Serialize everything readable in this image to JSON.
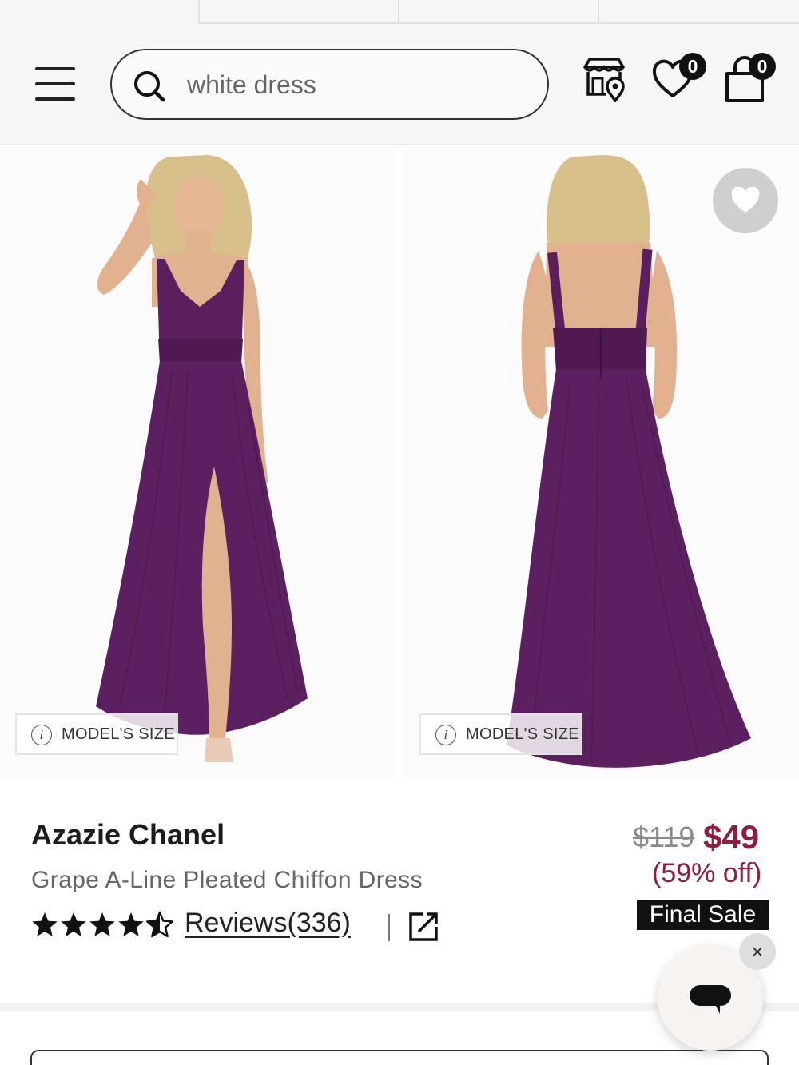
{
  "header": {
    "menu_icon": "hamburger-menu-icon",
    "search": {
      "value": "white dress",
      "placeholder": "",
      "icon": "search-icon"
    },
    "store_icon": "store-locator-icon",
    "wishlist": {
      "icon": "heart-icon",
      "count": "0"
    },
    "cart": {
      "icon": "shopping-bag-icon",
      "count": "0"
    }
  },
  "gallery": {
    "images": [
      {
        "alt": "Front view of model in grape chiffon dress",
        "model_size_label": "MODEL'S SIZE"
      },
      {
        "alt": "Back view of model in grape chiffon dress",
        "model_size_label": "MODEL'S SIZE"
      }
    ],
    "info_glyph": "i",
    "favorite_icon": "heart-icon"
  },
  "product": {
    "name": "Azazie Chanel",
    "description": "Grape A-Line Pleated Chiffon Dress",
    "rating": 4.5,
    "rating_max": 5,
    "reviews_label": "Reviews(336)",
    "share_icon": "external-link-icon"
  },
  "pricing": {
    "original": "$119",
    "sale": "$49",
    "discount": "(59% off)",
    "badge": "Final Sale"
  },
  "widgets": {
    "close_glyph": "×",
    "chat_icon": "chat-bubble-icon"
  },
  "colors": {
    "accent": "#8f1d3e",
    "dress": "#5a1f5c",
    "header_bg": "#f7f6f4"
  }
}
